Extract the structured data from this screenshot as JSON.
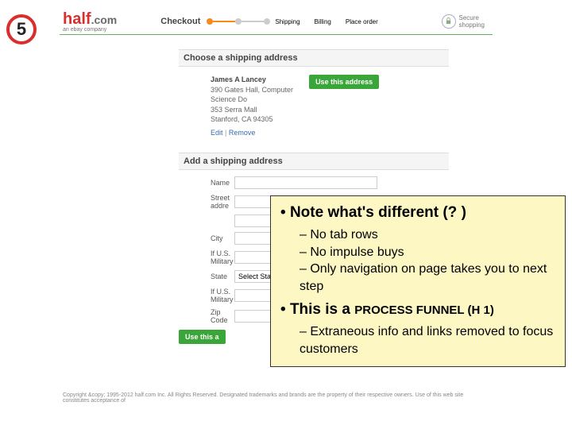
{
  "badge": "5",
  "header": {
    "logo_half": "half",
    "logo_com": ".com",
    "logo_sub": "an ebay company",
    "checkout": "Checkout",
    "steps": [
      "Shipping",
      "Billing",
      "Place order"
    ],
    "secure_top": "Secure",
    "secure_bottom": "shopping"
  },
  "section1": {
    "title": "Choose a shipping address",
    "name": "James A Lancey",
    "line1": "390 Gates Hall, Computer",
    "line2": "Science Do",
    "line3": "353 Serra Mall",
    "line4": "Stanford, CA 94305",
    "edit": "Edit",
    "remove": "Remove",
    "button": "Use this address"
  },
  "section2": {
    "title": "Add a shipping address",
    "labels": {
      "name": "Name",
      "street": "Street addre",
      "city": "City",
      "military1": "If U.S. Military",
      "state": "State",
      "military2": "If U.S. Military",
      "zip": "Zip Code"
    },
    "state_select": "Select Stat",
    "button": "Use this a"
  },
  "footer": "Copyright &copy; 1995-2012 half.com Inc. All Rights Reserved. Designated trademarks and brands are the property of their respective owners. Use of this web site constitutes acceptance of",
  "annot": {
    "h1": "Note what's different (? )",
    "subs1": [
      "No tab rows",
      "No impulse buys",
      "Only navigation on page takes you to next step"
    ],
    "h2_a": "This is a ",
    "h2_b": "PROCESS FUNNEL (H 1)",
    "subs2": [
      "Extraneous info and links removed to focus customers"
    ]
  }
}
